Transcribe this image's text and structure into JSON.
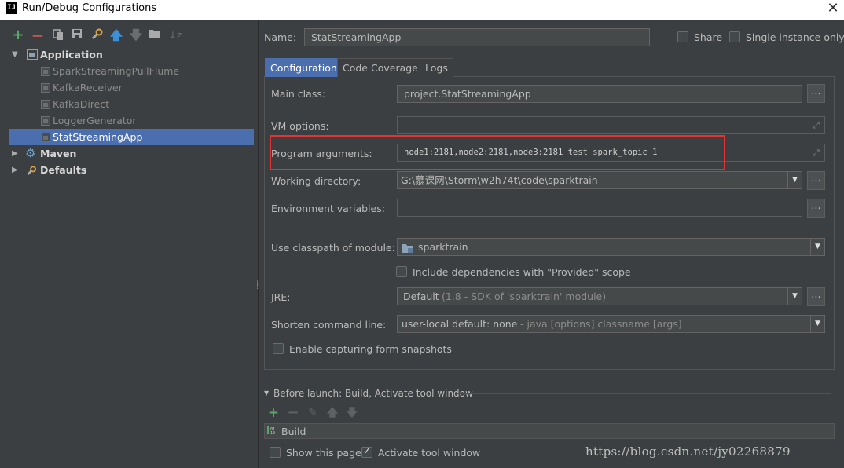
{
  "window": {
    "app_icon": "IJ",
    "title": "Run/Debug Configurations"
  },
  "icons": {
    "add": "plus-icon",
    "remove": "minus-icon",
    "copy": "copy-icon",
    "save": "save-icon",
    "edit_defaults": "wrench-icon",
    "move_up": "arrow-up-icon",
    "move_down": "arrow-down-icon",
    "folder": "folder-icon",
    "sort": "sort-icon"
  },
  "tree": {
    "application": {
      "label": "Application",
      "children": [
        "SparkStreamingPullFlume",
        "KafkaReceiver",
        "KafkaDirect",
        "LoggerGenerator",
        "StatStreamingApp"
      ],
      "selected": "StatStreamingApp"
    },
    "maven": "Maven",
    "defaults": "Defaults"
  },
  "form": {
    "name_label": "Name:",
    "name_value": "StatStreamingApp",
    "share_label": "Share",
    "single_instance_label": "Single instance only",
    "tabs": [
      "Configuration",
      "Code Coverage",
      "Logs"
    ],
    "active_tab": "Configuration",
    "main_class_label": "Main class:",
    "main_class_value": "project.StatStreamingApp",
    "vm_options_label": "VM options:",
    "vm_options_value": "",
    "program_args_label": "Program arguments:",
    "program_args_value": "node1:2181,node2:2181,node3:2181 test spark_topic 1",
    "working_dir_label": "Working directory:",
    "working_dir_value": "G:\\慕课网\\Storm\\w2h74t\\code\\sparktrain",
    "env_vars_label": "Environment variables:",
    "env_vars_value": "",
    "classpath_label": "Use classpath of module:",
    "classpath_value": "sparktrain",
    "include_deps_label": "Include dependencies with \"Provided\" scope",
    "jre_label": "JRE:",
    "jre_value_main": "Default",
    "jre_value_detail": "(1.8 - SDK of 'sparktrain' module)",
    "shorten_label": "Shorten command line:",
    "shorten_value_main": "user-local default: none",
    "shorten_value_detail": "- java [options] classname [args]",
    "snapshots_label": "Enable capturing form snapshots",
    "dots": "..."
  },
  "before_launch": {
    "header": "Before launch: Build, Activate tool window",
    "task": "Build",
    "show_page_label": "Show this page",
    "activate_label": "Activate tool window"
  },
  "checkboxes": {
    "share": false,
    "single_instance": false,
    "include_deps": false,
    "snapshots": false,
    "show_page": false,
    "activate": true
  },
  "watermark": "https://blog.csdn.net/jy02268879"
}
